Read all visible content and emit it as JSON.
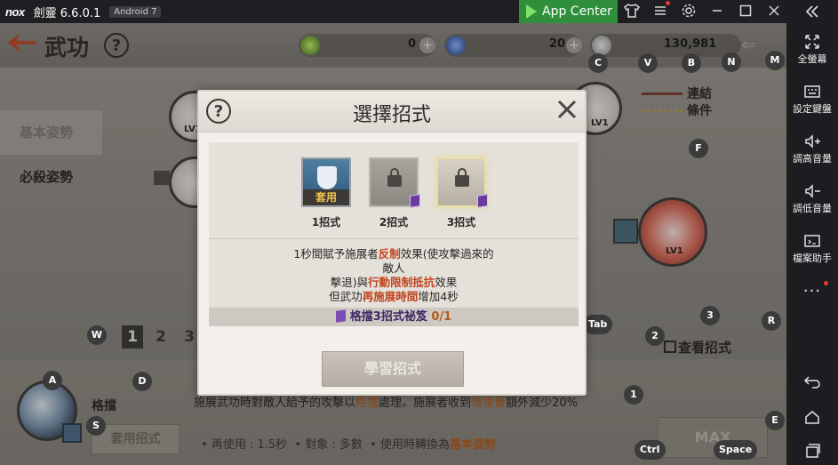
{
  "emulator": {
    "logo": "nox",
    "app_title": "劍靈 6.6.0.1",
    "android_badge": "Android 7",
    "app_center": "App Center"
  },
  "sidebar": {
    "items": [
      {
        "label": "全螢幕",
        "icon": "fullscreen-icon"
      },
      {
        "label": "設定鍵盤",
        "icon": "keyboard-icon"
      },
      {
        "label": "調高音量",
        "icon": "volume-up-icon"
      },
      {
        "label": "調低音量",
        "icon": "volume-down-icon"
      },
      {
        "label": "檔案助手",
        "icon": "file-assistant-icon"
      }
    ],
    "more": "..."
  },
  "game": {
    "title": "武功",
    "help": "?",
    "resources": {
      "r1_value": "0",
      "r2_value": "20",
      "gold_value": "130,981"
    },
    "stances": [
      "基本姿勢",
      "必殺姿勢"
    ],
    "legend": {
      "link": "連結",
      "condition": "條件"
    },
    "pages": [
      "1",
      "2",
      "3"
    ],
    "view_moves": "查看招式",
    "skill_name": "格擋",
    "apply_button": "套用招式",
    "description_pre": "施展武功時對敵人給予的攻擊以",
    "description_hl1": "格擋",
    "description_mid": "處理。施展者收到",
    "description_hl2": "傷害量",
    "description_post": "額外減少20%",
    "stats": {
      "reuse": "再使用 : 1.5秒",
      "target": "對象 : 多數",
      "switch_pre": "使用時轉換為",
      "switch_hl": "基本姿勢"
    },
    "max_button": "MAX"
  },
  "keyhints": {
    "C": "C",
    "V": "V",
    "B": "B",
    "N": "N",
    "M": "M",
    "F": "F",
    "W": "W",
    "A": "A",
    "D": "D",
    "S": "S",
    "Tab": "Tab",
    "k1": "1",
    "k2": "2",
    "k3": "3",
    "R": "R",
    "E": "E",
    "Ctrl": "Ctrl",
    "Space": "Space"
  },
  "modal": {
    "title": "選擇招式",
    "help": "?",
    "close": "✕",
    "moves": [
      {
        "label": "1招式",
        "tag": "套用",
        "state": "applied"
      },
      {
        "label": "2招式",
        "state": "locked"
      },
      {
        "label": "3招式",
        "state": "locked-selected"
      }
    ],
    "effect": {
      "l1_pre": "1秒間賦予施展者",
      "l1_hl": "反制",
      "l1_post": "效果(使攻擊過來的",
      "l2": "敵人",
      "l3_pre": "擊退)與",
      "l3_hl": "行動限制抵抗",
      "l3_post": "效果",
      "l4_pre": "但武功",
      "l4_hl": "再施展時間",
      "l4_post": "增加4秒"
    },
    "book": {
      "label": "格擋3招式祕笈",
      "count": "0/1"
    },
    "learn_button": "學習招式"
  }
}
